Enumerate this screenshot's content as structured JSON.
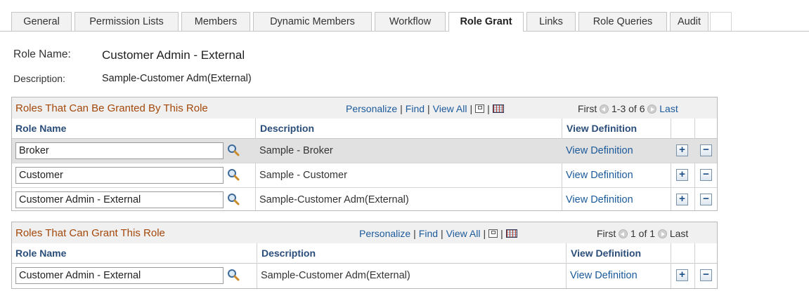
{
  "tabs": [
    {
      "label": "General"
    },
    {
      "label": "Permission Lists"
    },
    {
      "label": "Members"
    },
    {
      "label": "Dynamic Members"
    },
    {
      "label": "Workflow"
    },
    {
      "label": "Role Grant",
      "active": true
    },
    {
      "label": "Links"
    },
    {
      "label": "Role Queries"
    },
    {
      "label": "Audit"
    }
  ],
  "header": {
    "role_name_label": "Role Name:",
    "role_name_value": "Customer Admin - External",
    "description_label": "Description:",
    "description_value": "Sample-Customer Adm(External)"
  },
  "grid1": {
    "title": "Roles That Can Be Granted By This Role",
    "personalize": "Personalize",
    "find": "Find",
    "view_all": "View All",
    "first": "First",
    "range": "1-3 of 6",
    "last": "Last",
    "col_role": "Role Name",
    "col_desc": "Description",
    "col_view": "View Definition",
    "rows": [
      {
        "role": "Broker",
        "desc": "Sample - Broker",
        "link": "View Definition"
      },
      {
        "role": "Customer",
        "desc": "Sample - Customer",
        "link": "View Definition"
      },
      {
        "role": "Customer Admin - External",
        "desc": "Sample-Customer Adm(External)",
        "link": "View Definition"
      }
    ]
  },
  "grid2": {
    "title": "Roles That Can Grant This Role",
    "personalize": "Personalize",
    "find": "Find",
    "view_all": "View All",
    "first": "First",
    "range": "1 of 1",
    "last": "Last",
    "col_role": "Role Name",
    "col_desc": "Description",
    "col_view": "View Definition",
    "rows": [
      {
        "role": "Customer Admin - External",
        "desc": "Sample-Customer Adm(External)",
        "link": "View Definition"
      }
    ]
  },
  "buttons": {
    "add": "+",
    "delete": "−"
  },
  "icons": {
    "lookup": "magnifier-icon",
    "new_window": "new-window-icon",
    "download": "download-to-spreadsheet-icon",
    "prev": "prev-arrow-icon",
    "next": "next-arrow-icon"
  },
  "colors": {
    "grid_title": "#a3480a",
    "link": "#1b5a9b",
    "column_header": "#2a4d7a",
    "selected_row": "#e1e1e1"
  }
}
